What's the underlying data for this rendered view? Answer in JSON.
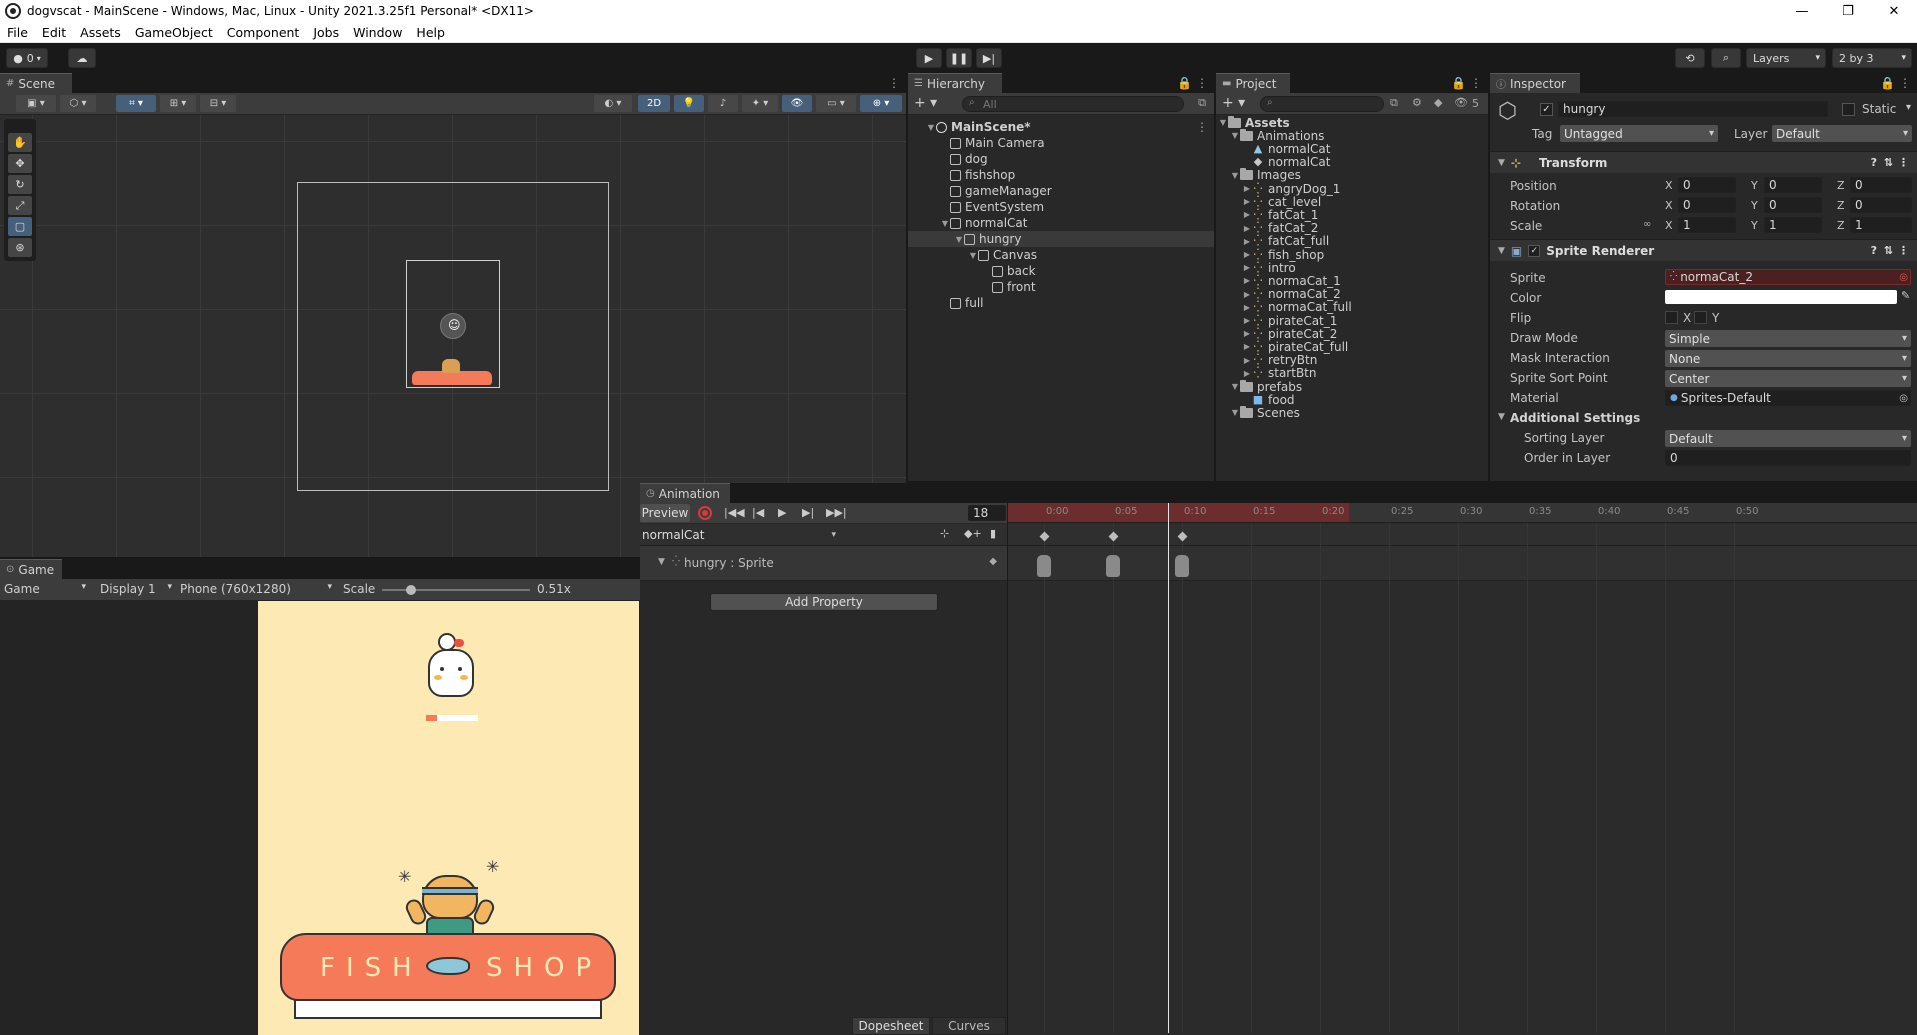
{
  "window": {
    "title": "dogvscat - MainScene - Windows, Mac, Linux - Unity 2021.3.25f1 Personal* <DX11>",
    "minimize": "—",
    "maximize": "❐",
    "close": "✕"
  },
  "menu": [
    "File",
    "Edit",
    "Assets",
    "GameObject",
    "Component",
    "Jobs",
    "Window",
    "Help"
  ],
  "toolbar": {
    "account_count": "0",
    "layers_label": "Layers",
    "layout_label": "2 by 3"
  },
  "scene": {
    "tab": "Scene",
    "mode_2d": "2D"
  },
  "game": {
    "tab": "Game",
    "view_select": "Game",
    "display": "Display 1",
    "resolution": "Phone (760x1280)",
    "scale_label": "Scale",
    "scale_value": "0.51x",
    "shop_word1": "FISH",
    "shop_word2": "SHOP"
  },
  "hierarchy": {
    "tab": "Hierarchy",
    "search_placeholder": "All",
    "items": [
      {
        "label": "MainScene*",
        "depth": 0,
        "bold": true,
        "arrow": "▼",
        "icon": "scene"
      },
      {
        "label": "Main Camera",
        "depth": 1,
        "arrow": "",
        "icon": "cube"
      },
      {
        "label": "dog",
        "depth": 1,
        "arrow": "",
        "icon": "cube"
      },
      {
        "label": "fishshop",
        "depth": 1,
        "arrow": "",
        "icon": "cube"
      },
      {
        "label": "gameManager",
        "depth": 1,
        "arrow": "",
        "icon": "cube"
      },
      {
        "label": "EventSystem",
        "depth": 1,
        "arrow": "",
        "icon": "cube"
      },
      {
        "label": "normalCat",
        "depth": 1,
        "arrow": "▼",
        "icon": "cube"
      },
      {
        "label": "hungry",
        "depth": 2,
        "arrow": "▼",
        "icon": "cube",
        "selected": true
      },
      {
        "label": "Canvas",
        "depth": 3,
        "arrow": "▼",
        "icon": "cube"
      },
      {
        "label": "back",
        "depth": 4,
        "arrow": "",
        "icon": "cube"
      },
      {
        "label": "front",
        "depth": 4,
        "arrow": "",
        "icon": "cube"
      },
      {
        "label": "full",
        "depth": 1,
        "arrow": "",
        "icon": "cube"
      }
    ]
  },
  "project": {
    "tab": "Project",
    "hidden_count": "5",
    "items": [
      {
        "label": "Assets",
        "depth": 0,
        "arrow": "▼",
        "icon": "folder",
        "bold": true
      },
      {
        "label": "Animations",
        "depth": 1,
        "arrow": "▼",
        "icon": "folder"
      },
      {
        "label": "normalCat",
        "depth": 2,
        "arrow": "",
        "icon": "anim"
      },
      {
        "label": "normalCat",
        "depth": 2,
        "arrow": "",
        "icon": "controller"
      },
      {
        "label": "Images",
        "depth": 1,
        "arrow": "▼",
        "icon": "folder"
      },
      {
        "label": "angryDog_1",
        "depth": 2,
        "arrow": "▶",
        "icon": "sprite"
      },
      {
        "label": "cat_level",
        "depth": 2,
        "arrow": "▶",
        "icon": "sprite"
      },
      {
        "label": "fatCat_1",
        "depth": 2,
        "arrow": "▶",
        "icon": "sprite"
      },
      {
        "label": "fatCat_2",
        "depth": 2,
        "arrow": "▶",
        "icon": "sprite"
      },
      {
        "label": "fatCat_full",
        "depth": 2,
        "arrow": "▶",
        "icon": "sprite"
      },
      {
        "label": "fish_shop",
        "depth": 2,
        "arrow": "▶",
        "icon": "sprite"
      },
      {
        "label": "intro",
        "depth": 2,
        "arrow": "▶",
        "icon": "sprite"
      },
      {
        "label": "normaCat_1",
        "depth": 2,
        "arrow": "▶",
        "icon": "sprite"
      },
      {
        "label": "normaCat_2",
        "depth": 2,
        "arrow": "▶",
        "icon": "sprite"
      },
      {
        "label": "normaCat_full",
        "depth": 2,
        "arrow": "▶",
        "icon": "sprite"
      },
      {
        "label": "pirateCat_1",
        "depth": 2,
        "arrow": "▶",
        "icon": "sprite"
      },
      {
        "label": "pirateCat_2",
        "depth": 2,
        "arrow": "▶",
        "icon": "sprite"
      },
      {
        "label": "pirateCat_full",
        "depth": 2,
        "arrow": "▶",
        "icon": "sprite"
      },
      {
        "label": "retryBtn",
        "depth": 2,
        "arrow": "▶",
        "icon": "sprite"
      },
      {
        "label": "startBtn",
        "depth": 2,
        "arrow": "▶",
        "icon": "sprite"
      },
      {
        "label": "prefabs",
        "depth": 1,
        "arrow": "▼",
        "icon": "folder"
      },
      {
        "label": "food",
        "depth": 2,
        "arrow": "",
        "icon": "prefab"
      },
      {
        "label": "Scenes",
        "depth": 1,
        "arrow": "▼",
        "icon": "folder"
      }
    ]
  },
  "inspector": {
    "tab": "Inspector",
    "object_name": "hungry",
    "static_label": "Static",
    "tag_label": "Tag",
    "tag_value": "Untagged",
    "layer_label": "Layer",
    "layer_value": "Default",
    "transform": {
      "title": "Transform",
      "position": {
        "label": "Position",
        "x": "0",
        "y": "0",
        "z": "0"
      },
      "rotation": {
        "label": "Rotation",
        "x": "0",
        "y": "0",
        "z": "0"
      },
      "scale": {
        "label": "Scale",
        "x": "1",
        "y": "1",
        "z": "1"
      }
    },
    "sprite_renderer": {
      "title": "Sprite Renderer",
      "sprite_label": "Sprite",
      "sprite_value": "normaCat_2",
      "color_label": "Color",
      "color_value": "#ffffff",
      "flip_label": "Flip",
      "flip_x": "X",
      "flip_y": "Y",
      "draw_mode_label": "Draw Mode",
      "draw_mode_value": "Simple",
      "mask_label": "Mask Interaction",
      "mask_value": "None",
      "sort_point_label": "Sprite Sort Point",
      "sort_point_value": "Center",
      "material_label": "Material",
      "material_value": "Sprites-Default",
      "additional_label": "Additional Settings",
      "sorting_layer_label": "Sorting Layer",
      "sorting_layer_value": "Default",
      "order_label": "Order in Layer",
      "order_value": "0"
    }
  },
  "animation": {
    "tab": "Animation",
    "preview_label": "Preview",
    "frame_value": "18",
    "clip_name": "normalCat",
    "property_label": "hungry : Sprite",
    "add_property": "Add Property",
    "dopesheet_tab": "Dopesheet",
    "curves_tab": "Curves",
    "ticks": [
      "0:00",
      "0:05",
      "0:10",
      "0:15",
      "0:20",
      "0:25",
      "0:30",
      "0:35",
      "0:40",
      "0:45",
      "0:50"
    ],
    "playhead_frame": 18,
    "keyframes": [
      0,
      10,
      20
    ]
  },
  "colors": {
    "accent_blue": "#46607c",
    "record_red": "#d63b3b",
    "timeline_red": "#6b2d2d",
    "game_bg": "#fde9b4",
    "shop_awning": "#f47a5a"
  }
}
